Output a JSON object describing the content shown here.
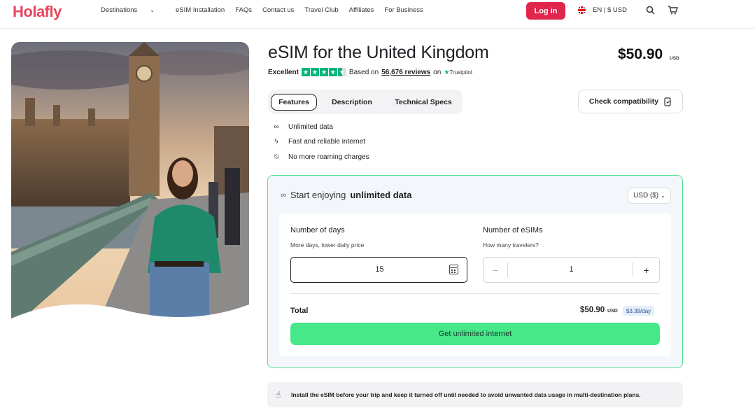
{
  "brand": {
    "logo": "Holafly",
    "color": "#e6485e"
  },
  "nav": {
    "items": [
      {
        "label": "Destinations",
        "has_dropdown": true
      },
      {
        "label": "eSIM Installation"
      },
      {
        "label": "FAQs"
      },
      {
        "label": "Contact us"
      },
      {
        "label": "Travel Club"
      },
      {
        "label": "Affiliates"
      },
      {
        "label": "For Business"
      }
    ],
    "login_label": "Log in",
    "locale_label": "EN | $ USD",
    "icons": [
      "uk-flag-icon",
      "search-icon",
      "cart-icon"
    ]
  },
  "product": {
    "title": "eSIM for the United Kingdom",
    "price": "$50.90",
    "price_unit": "USD",
    "rating_label": "Excellent",
    "stars": 4.5,
    "based_on_label": "Based on",
    "reviews_label": "56,676 reviews",
    "on_label": "on",
    "trustpilot_label": "Trustpilot"
  },
  "tabs": [
    {
      "label": "Features",
      "active": true
    },
    {
      "label": "Description",
      "active": false
    },
    {
      "label": "Technical Specs",
      "active": false
    }
  ],
  "check_compat_label": "Check compatibility",
  "features": [
    {
      "icon": "infinity-icon",
      "label": "Unlimited data"
    },
    {
      "icon": "lightning-icon",
      "label": "Fast and reliable internet"
    },
    {
      "icon": "no-roaming-icon",
      "label": "No more roaming charges"
    }
  ],
  "card": {
    "heading_prefix": "Start enjoying",
    "heading_bold": "unlimited data",
    "currency_select": "USD ($)",
    "days_label": "Number of days",
    "days_sub": "More days, lower daily price",
    "days_value": "15",
    "esims_label": "Number of eSIMs",
    "esims_sub": "How many travelers?",
    "esims_value": "1",
    "minus_label": "−",
    "plus_label": "+",
    "total_label": "Total",
    "total_value": "$50.90",
    "total_unit": "USD",
    "per_day": "$3.39/day",
    "cta_label": "Get unlimited internet",
    "accent": "#46e88a"
  },
  "notice": {
    "text": "Install the eSIM before your trip and keep it turned off until needed to avoid unwanted data usage in multi-destination plans."
  }
}
